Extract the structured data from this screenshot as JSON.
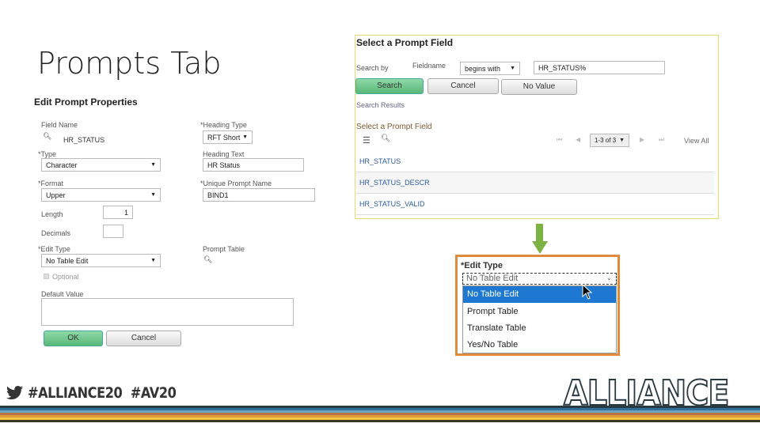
{
  "slide": {
    "title": "Prompts Tab"
  },
  "edit_prompt": {
    "heading": "Edit Prompt Properties",
    "field_name_label": "Field Name",
    "field_name_value": "HR_STATUS",
    "heading_type_label": "*Heading Type",
    "heading_type_value": "RFT Short",
    "type_label": "*Type",
    "type_value": "Character",
    "heading_text_label": "Heading Text",
    "heading_text_value": "HR Status",
    "format_label": "*Format",
    "format_value": "Upper",
    "unique_prompt_label": "*Unique Prompt Name",
    "unique_prompt_value": "BIND1",
    "length_label": "Length",
    "length_value": "1",
    "decimals_label": "Decimals",
    "decimals_value": "",
    "edit_type_label": "*Edit Type",
    "edit_type_value": "No Table Edit",
    "prompt_table_label": "Prompt Table",
    "optional_label": "Optional",
    "optional_checked": false,
    "default_value_label": "Default Value",
    "default_value": "",
    "ok_label": "OK",
    "cancel_label": "Cancel"
  },
  "select_prompt": {
    "heading": "Select a Prompt Field",
    "search_by_label": "Search by",
    "fieldname_label": "Fieldname",
    "operator_value": "begins with",
    "search_value": "HR_STATUS%",
    "search_label": "Search",
    "cancel_label": "Cancel",
    "no_value_label": "No Value",
    "results_label": "Search Results",
    "grid_title": "Select a Prompt Field",
    "pager": "1-3 of 3",
    "view_all": "View All",
    "results": [
      "HR_STATUS",
      "HR_STATUS_DESCR",
      "HR_STATUS_VALID"
    ]
  },
  "edit_type_dropdown": {
    "label": "*Edit Type",
    "current": "No Table Edit",
    "options": [
      "No Table Edit",
      "Prompt Table",
      "Translate Table",
      "Yes/No Table"
    ],
    "highlighted": "No Table Edit"
  },
  "footer": {
    "hashtags": "#ALLIANCE20  #AV20",
    "logo": "ALLIANCE"
  },
  "colors": {
    "accent_green": "#58b878",
    "highlight_blue": "#1e78d2",
    "frame_orange": "#e08a3c",
    "arrow_green": "#7cb342"
  }
}
